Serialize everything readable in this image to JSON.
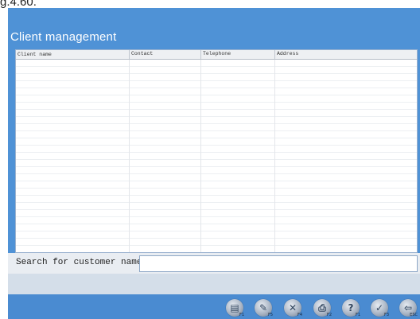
{
  "caption": "g.4.60.",
  "window": {
    "title": "Client management"
  },
  "table": {
    "columns": [
      "Client name",
      "Contact",
      "Telephone",
      "Address"
    ],
    "rows": []
  },
  "search": {
    "label": "Search for customer name",
    "value": ""
  },
  "toolbar": {
    "buttons": [
      {
        "icon": "new-record-icon",
        "glyph": "▤",
        "key": "F1"
      },
      {
        "icon": "edit-icon",
        "glyph": "✎",
        "key": "F5"
      },
      {
        "icon": "delete-icon",
        "glyph": "✕",
        "key": "F4"
      },
      {
        "icon": "print-icon",
        "glyph": "⎙",
        "key": "F2"
      },
      {
        "icon": "help-icon",
        "glyph": "?",
        "key": "F1"
      },
      {
        "icon": "confirm-icon",
        "glyph": "✓",
        "key": "F3"
      },
      {
        "icon": "exit-icon",
        "glyph": "⇦",
        "key": "ESC"
      }
    ]
  }
}
